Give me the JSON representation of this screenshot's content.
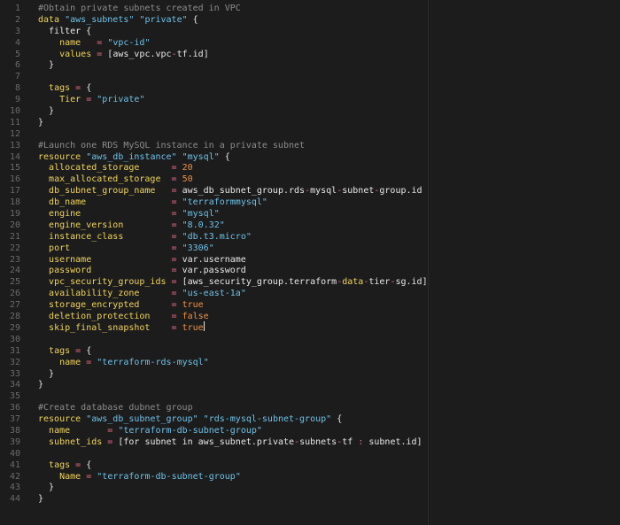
{
  "theme": {
    "background": "#1c1c1c",
    "line_number": "#6a6a6a",
    "plain": "#e8e8e8",
    "comment": "#8c8c8c",
    "keyword": "#f2d45a",
    "string": "#6fc1e8",
    "number": "#ee8f43",
    "operator": "#e86a82"
  },
  "editor": {
    "cursor_line": 29,
    "lines": [
      {
        "n": "1",
        "tokens": [
          {
            "t": "#Obtain private subnets created in VPC",
            "c": "comment"
          }
        ]
      },
      {
        "n": "2",
        "tokens": [
          {
            "t": "data",
            "c": "keyword"
          },
          {
            "t": " ",
            "c": "plain"
          },
          {
            "t": "\"aws_subnets\"",
            "c": "string"
          },
          {
            "t": " ",
            "c": "plain"
          },
          {
            "t": "\"private\"",
            "c": "string"
          },
          {
            "t": " {",
            "c": "plain"
          }
        ]
      },
      {
        "n": "3",
        "tokens": [
          {
            "t": "  filter {",
            "c": "plain"
          }
        ]
      },
      {
        "n": "4",
        "tokens": [
          {
            "t": "    ",
            "c": "plain"
          },
          {
            "t": "name",
            "c": "keyword"
          },
          {
            "t": "   ",
            "c": "plain"
          },
          {
            "t": "=",
            "c": "operator"
          },
          {
            "t": " ",
            "c": "plain"
          },
          {
            "t": "\"vpc-id\"",
            "c": "string"
          }
        ]
      },
      {
        "n": "5",
        "tokens": [
          {
            "t": "    ",
            "c": "plain"
          },
          {
            "t": "values",
            "c": "keyword"
          },
          {
            "t": " ",
            "c": "plain"
          },
          {
            "t": "=",
            "c": "operator"
          },
          {
            "t": " [aws_vpc.vpc",
            "c": "plain"
          },
          {
            "t": "-",
            "c": "operator"
          },
          {
            "t": "tf.id]",
            "c": "plain"
          }
        ]
      },
      {
        "n": "6",
        "tokens": [
          {
            "t": "  }",
            "c": "plain"
          }
        ]
      },
      {
        "n": "7",
        "tokens": []
      },
      {
        "n": "8",
        "tokens": [
          {
            "t": "  ",
            "c": "plain"
          },
          {
            "t": "tags",
            "c": "keyword"
          },
          {
            "t": " ",
            "c": "plain"
          },
          {
            "t": "=",
            "c": "operator"
          },
          {
            "t": " {",
            "c": "plain"
          }
        ]
      },
      {
        "n": "9",
        "tokens": [
          {
            "t": "    ",
            "c": "plain"
          },
          {
            "t": "Tier",
            "c": "keyword"
          },
          {
            "t": " ",
            "c": "plain"
          },
          {
            "t": "=",
            "c": "operator"
          },
          {
            "t": " ",
            "c": "plain"
          },
          {
            "t": "\"private\"",
            "c": "string"
          }
        ]
      },
      {
        "n": "10",
        "tokens": [
          {
            "t": "  }",
            "c": "plain"
          }
        ]
      },
      {
        "n": "11",
        "tokens": [
          {
            "t": "}",
            "c": "plain"
          }
        ]
      },
      {
        "n": "12",
        "tokens": []
      },
      {
        "n": "13",
        "tokens": [
          {
            "t": "#Launch one RDS MySQL instance in a private subnet",
            "c": "comment"
          }
        ]
      },
      {
        "n": "14",
        "tokens": [
          {
            "t": "resource",
            "c": "keyword"
          },
          {
            "t": " ",
            "c": "plain"
          },
          {
            "t": "\"aws_db_instance\"",
            "c": "string"
          },
          {
            "t": " ",
            "c": "plain"
          },
          {
            "t": "\"mysql\"",
            "c": "string"
          },
          {
            "t": " {",
            "c": "plain"
          }
        ]
      },
      {
        "n": "15",
        "tokens": [
          {
            "t": "  ",
            "c": "plain"
          },
          {
            "t": "allocated_storage",
            "c": "keyword"
          },
          {
            "t": "      ",
            "c": "plain"
          },
          {
            "t": "=",
            "c": "operator"
          },
          {
            "t": " ",
            "c": "plain"
          },
          {
            "t": "20",
            "c": "number"
          }
        ]
      },
      {
        "n": "16",
        "tokens": [
          {
            "t": "  ",
            "c": "plain"
          },
          {
            "t": "max_allocated_storage",
            "c": "keyword"
          },
          {
            "t": "  ",
            "c": "plain"
          },
          {
            "t": "=",
            "c": "operator"
          },
          {
            "t": " ",
            "c": "plain"
          },
          {
            "t": "50",
            "c": "number"
          }
        ]
      },
      {
        "n": "17",
        "tokens": [
          {
            "t": "  ",
            "c": "plain"
          },
          {
            "t": "db_subnet_group_name",
            "c": "keyword"
          },
          {
            "t": "   ",
            "c": "plain"
          },
          {
            "t": "=",
            "c": "operator"
          },
          {
            "t": " aws_db_subnet_group.rds",
            "c": "plain"
          },
          {
            "t": "-",
            "c": "operator"
          },
          {
            "t": "mysql",
            "c": "plain"
          },
          {
            "t": "-",
            "c": "operator"
          },
          {
            "t": "subnet",
            "c": "plain"
          },
          {
            "t": "-",
            "c": "operator"
          },
          {
            "t": "group.id",
            "c": "plain"
          }
        ]
      },
      {
        "n": "18",
        "tokens": [
          {
            "t": "  ",
            "c": "plain"
          },
          {
            "t": "db_name",
            "c": "keyword"
          },
          {
            "t": "                ",
            "c": "plain"
          },
          {
            "t": "=",
            "c": "operator"
          },
          {
            "t": " ",
            "c": "plain"
          },
          {
            "t": "\"terraformmysql\"",
            "c": "string"
          }
        ]
      },
      {
        "n": "19",
        "tokens": [
          {
            "t": "  ",
            "c": "plain"
          },
          {
            "t": "engine",
            "c": "keyword"
          },
          {
            "t": "                 ",
            "c": "plain"
          },
          {
            "t": "=",
            "c": "operator"
          },
          {
            "t": " ",
            "c": "plain"
          },
          {
            "t": "\"mysql\"",
            "c": "string"
          }
        ]
      },
      {
        "n": "20",
        "tokens": [
          {
            "t": "  ",
            "c": "plain"
          },
          {
            "t": "engine_version",
            "c": "keyword"
          },
          {
            "t": "         ",
            "c": "plain"
          },
          {
            "t": "=",
            "c": "operator"
          },
          {
            "t": " ",
            "c": "plain"
          },
          {
            "t": "\"8.0.32\"",
            "c": "string"
          }
        ]
      },
      {
        "n": "21",
        "tokens": [
          {
            "t": "  ",
            "c": "plain"
          },
          {
            "t": "instance_class",
            "c": "keyword"
          },
          {
            "t": "         ",
            "c": "plain"
          },
          {
            "t": "=",
            "c": "operator"
          },
          {
            "t": " ",
            "c": "plain"
          },
          {
            "t": "\"db.t3.micro\"",
            "c": "string"
          }
        ]
      },
      {
        "n": "22",
        "tokens": [
          {
            "t": "  ",
            "c": "plain"
          },
          {
            "t": "port",
            "c": "keyword"
          },
          {
            "t": "                   ",
            "c": "plain"
          },
          {
            "t": "=",
            "c": "operator"
          },
          {
            "t": " ",
            "c": "plain"
          },
          {
            "t": "\"3306\"",
            "c": "string"
          }
        ]
      },
      {
        "n": "23",
        "tokens": [
          {
            "t": "  ",
            "c": "plain"
          },
          {
            "t": "username",
            "c": "keyword"
          },
          {
            "t": "               ",
            "c": "plain"
          },
          {
            "t": "=",
            "c": "operator"
          },
          {
            "t": " var.username",
            "c": "plain"
          }
        ]
      },
      {
        "n": "24",
        "tokens": [
          {
            "t": "  ",
            "c": "plain"
          },
          {
            "t": "password",
            "c": "keyword"
          },
          {
            "t": "               ",
            "c": "plain"
          },
          {
            "t": "=",
            "c": "operator"
          },
          {
            "t": " var.password",
            "c": "plain"
          }
        ]
      },
      {
        "n": "25",
        "tokens": [
          {
            "t": "  ",
            "c": "plain"
          },
          {
            "t": "vpc_security_group_ids",
            "c": "keyword"
          },
          {
            "t": " ",
            "c": "plain"
          },
          {
            "t": "=",
            "c": "operator"
          },
          {
            "t": " [aws_security_group.terraform",
            "c": "plain"
          },
          {
            "t": "-",
            "c": "operator"
          },
          {
            "t": "data",
            "c": "keyword"
          },
          {
            "t": "-",
            "c": "operator"
          },
          {
            "t": "tier",
            "c": "plain"
          },
          {
            "t": "-",
            "c": "operator"
          },
          {
            "t": "sg.id]",
            "c": "plain"
          }
        ]
      },
      {
        "n": "26",
        "tokens": [
          {
            "t": "  ",
            "c": "plain"
          },
          {
            "t": "availability_zone",
            "c": "keyword"
          },
          {
            "t": "      ",
            "c": "plain"
          },
          {
            "t": "=",
            "c": "operator"
          },
          {
            "t": " ",
            "c": "plain"
          },
          {
            "t": "\"us-east-1a\"",
            "c": "string"
          }
        ]
      },
      {
        "n": "27",
        "tokens": [
          {
            "t": "  ",
            "c": "plain"
          },
          {
            "t": "storage_encrypted",
            "c": "keyword"
          },
          {
            "t": "      ",
            "c": "plain"
          },
          {
            "t": "=",
            "c": "operator"
          },
          {
            "t": " ",
            "c": "plain"
          },
          {
            "t": "true",
            "c": "number"
          }
        ]
      },
      {
        "n": "28",
        "tokens": [
          {
            "t": "  ",
            "c": "plain"
          },
          {
            "t": "deletion_protection",
            "c": "keyword"
          },
          {
            "t": "    ",
            "c": "plain"
          },
          {
            "t": "=",
            "c": "operator"
          },
          {
            "t": " ",
            "c": "plain"
          },
          {
            "t": "false",
            "c": "number"
          }
        ]
      },
      {
        "n": "29",
        "tokens": [
          {
            "t": "  ",
            "c": "plain"
          },
          {
            "t": "skip_final_snapshot",
            "c": "keyword"
          },
          {
            "t": "    ",
            "c": "plain"
          },
          {
            "t": "=",
            "c": "operator"
          },
          {
            "t": " ",
            "c": "plain"
          },
          {
            "t": "true",
            "c": "number"
          }
        ]
      },
      {
        "n": "30",
        "tokens": []
      },
      {
        "n": "31",
        "tokens": [
          {
            "t": "  ",
            "c": "plain"
          },
          {
            "t": "tags",
            "c": "keyword"
          },
          {
            "t": " ",
            "c": "plain"
          },
          {
            "t": "=",
            "c": "operator"
          },
          {
            "t": " {",
            "c": "plain"
          }
        ]
      },
      {
        "n": "32",
        "tokens": [
          {
            "t": "    ",
            "c": "plain"
          },
          {
            "t": "name",
            "c": "keyword"
          },
          {
            "t": " ",
            "c": "plain"
          },
          {
            "t": "=",
            "c": "operator"
          },
          {
            "t": " ",
            "c": "plain"
          },
          {
            "t": "\"terraform-rds-mysql\"",
            "c": "string"
          }
        ]
      },
      {
        "n": "33",
        "tokens": [
          {
            "t": "  }",
            "c": "plain"
          }
        ]
      },
      {
        "n": "34",
        "tokens": [
          {
            "t": "}",
            "c": "plain"
          }
        ]
      },
      {
        "n": "35",
        "tokens": []
      },
      {
        "n": "36",
        "tokens": [
          {
            "t": "#Create database dubnet group",
            "c": "comment"
          }
        ]
      },
      {
        "n": "37",
        "tokens": [
          {
            "t": "resource",
            "c": "keyword"
          },
          {
            "t": " ",
            "c": "plain"
          },
          {
            "t": "\"aws_db_subnet_group\"",
            "c": "string"
          },
          {
            "t": " ",
            "c": "plain"
          },
          {
            "t": "\"rds-mysql-subnet-group\"",
            "c": "string"
          },
          {
            "t": " {",
            "c": "plain"
          }
        ]
      },
      {
        "n": "38",
        "tokens": [
          {
            "t": "  ",
            "c": "plain"
          },
          {
            "t": "name",
            "c": "keyword"
          },
          {
            "t": "       ",
            "c": "plain"
          },
          {
            "t": "=",
            "c": "operator"
          },
          {
            "t": " ",
            "c": "plain"
          },
          {
            "t": "\"terraform-db-subnet-group\"",
            "c": "string"
          }
        ]
      },
      {
        "n": "39",
        "tokens": [
          {
            "t": "  ",
            "c": "plain"
          },
          {
            "t": "subnet_ids",
            "c": "keyword"
          },
          {
            "t": " ",
            "c": "plain"
          },
          {
            "t": "=",
            "c": "operator"
          },
          {
            "t": " [for subnet in aws_subnet.private",
            "c": "plain"
          },
          {
            "t": "-",
            "c": "operator"
          },
          {
            "t": "subnets",
            "c": "plain"
          },
          {
            "t": "-",
            "c": "operator"
          },
          {
            "t": "tf ",
            "c": "plain"
          },
          {
            "t": ":",
            "c": "operator"
          },
          {
            "t": " subnet.id]",
            "c": "plain"
          }
        ]
      },
      {
        "n": "40",
        "tokens": []
      },
      {
        "n": "41",
        "tokens": [
          {
            "t": "  ",
            "c": "plain"
          },
          {
            "t": "tags",
            "c": "keyword"
          },
          {
            "t": " ",
            "c": "plain"
          },
          {
            "t": "=",
            "c": "operator"
          },
          {
            "t": " {",
            "c": "plain"
          }
        ]
      },
      {
        "n": "42",
        "tokens": [
          {
            "t": "    ",
            "c": "plain"
          },
          {
            "t": "Name",
            "c": "keyword"
          },
          {
            "t": " ",
            "c": "plain"
          },
          {
            "t": "=",
            "c": "operator"
          },
          {
            "t": " ",
            "c": "plain"
          },
          {
            "t": "\"terraform-db-subnet-group\"",
            "c": "string"
          }
        ]
      },
      {
        "n": "43",
        "tokens": [
          {
            "t": "  }",
            "c": "plain"
          }
        ]
      },
      {
        "n": "44",
        "tokens": [
          {
            "t": "}",
            "c": "plain"
          }
        ]
      }
    ]
  }
}
